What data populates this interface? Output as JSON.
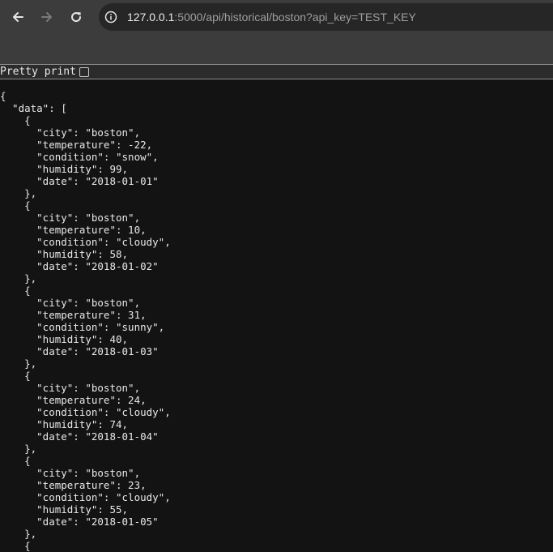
{
  "browser": {
    "url_host": "127.0.0.1",
    "url_rest": ":5000/api/historical/boston?api_key=TEST_KEY"
  },
  "page": {
    "pretty_print_label": "Pretty print",
    "pretty_print_checked": false,
    "json_lines": [
      "{",
      "  \"data\": [",
      "    {",
      "      \"city\": \"boston\",",
      "      \"temperature\": -22,",
      "      \"condition\": \"snow\",",
      "      \"humidity\": 99,",
      "      \"date\": \"2018-01-01\"",
      "    },",
      "    {",
      "      \"city\": \"boston\",",
      "      \"temperature\": 10,",
      "      \"condition\": \"cloudy\",",
      "      \"humidity\": 58,",
      "      \"date\": \"2018-01-02\"",
      "    },",
      "    {",
      "      \"city\": \"boston\",",
      "      \"temperature\": 31,",
      "      \"condition\": \"sunny\",",
      "      \"humidity\": 40,",
      "      \"date\": \"2018-01-03\"",
      "    },",
      "    {",
      "      \"city\": \"boston\",",
      "      \"temperature\": 24,",
      "      \"condition\": \"cloudy\",",
      "      \"humidity\": 74,",
      "      \"date\": \"2018-01-04\"",
      "    },",
      "    {",
      "      \"city\": \"boston\",",
      "      \"temperature\": 23,",
      "      \"condition\": \"cloudy\",",
      "      \"humidity\": 55,",
      "      \"date\": \"2018-01-05\"",
      "    },",
      "    {"
    ]
  }
}
